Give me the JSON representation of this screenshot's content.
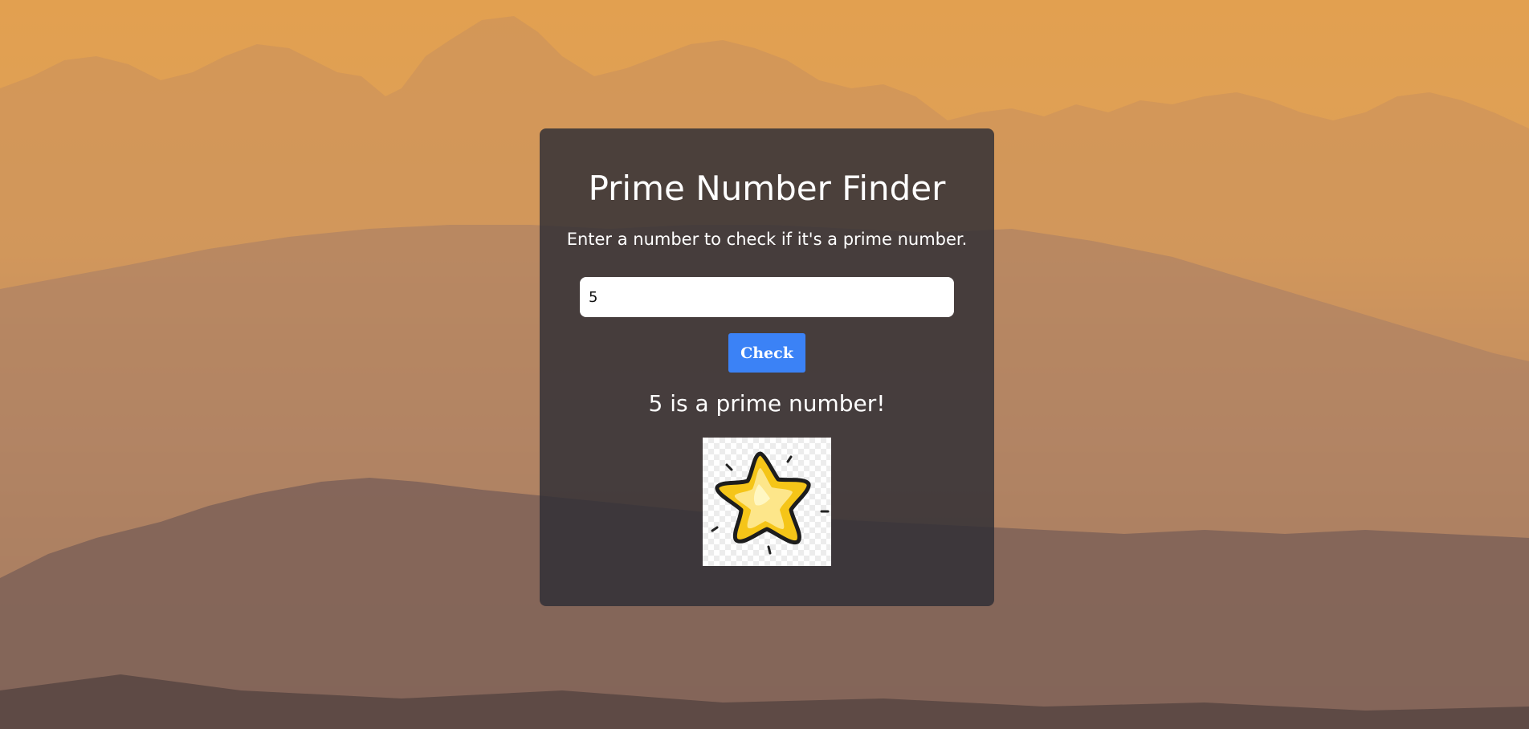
{
  "app": {
    "title": "Prime Number Finder",
    "subtitle": "Enter a number to check if it's a prime number."
  },
  "form": {
    "input_value": "5",
    "check_label": "Check"
  },
  "result": {
    "text": "5 is a prime number!",
    "image_icon": "star-icon"
  },
  "colors": {
    "button": "#3b82f6",
    "card": "#2d2d34",
    "star_fill": "#f5c518",
    "sky": "#e9a24e"
  }
}
